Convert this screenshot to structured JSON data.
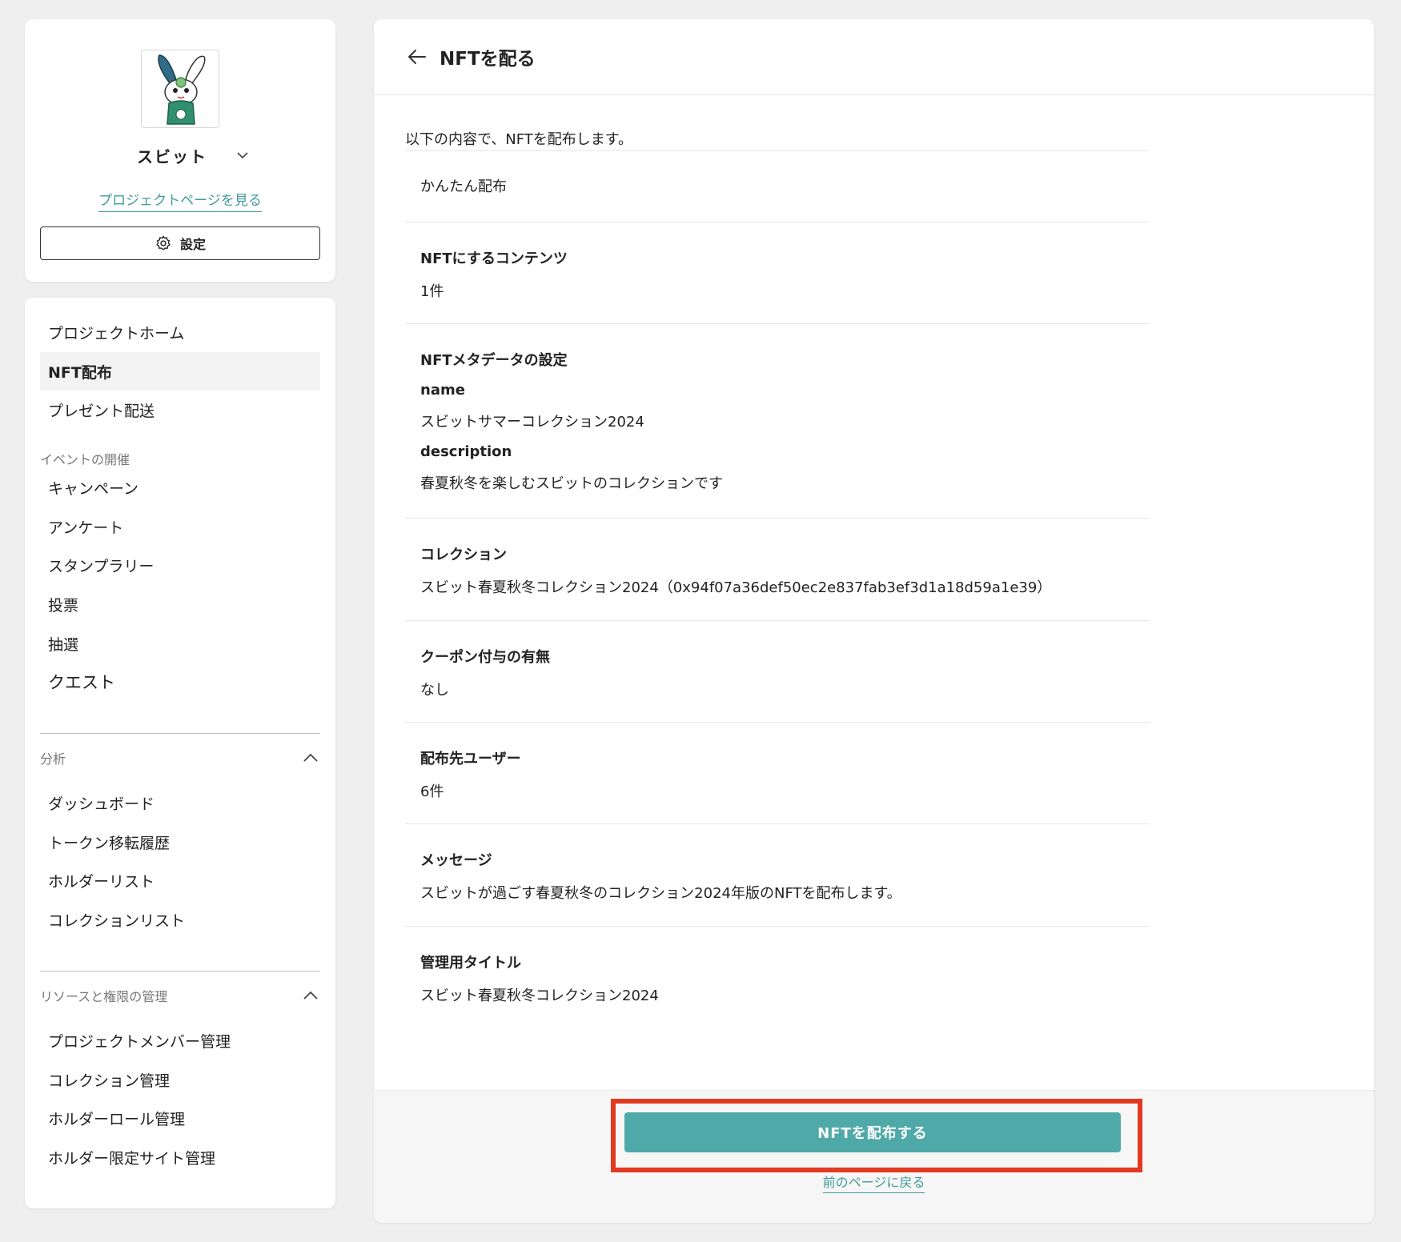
{
  "project": {
    "name": "スビット",
    "link_label": "プロジェクトページを見る",
    "settings_label": "設定"
  },
  "menu": {
    "top_items": [
      {
        "label": "プロジェクトホーム"
      },
      {
        "label": "NFT配布"
      },
      {
        "label": "プレゼント配送"
      }
    ],
    "event_group": {
      "title": "イベントの開催",
      "items": [
        {
          "label": "キャンペーン"
        },
        {
          "label": "アンケート"
        },
        {
          "label": "スタンプラリー"
        },
        {
          "label": "投票"
        },
        {
          "label": "抽選"
        },
        {
          "label": "クエスト"
        }
      ]
    },
    "analysis_group": {
      "title": "分析",
      "items": [
        {
          "label": "ダッシュボード"
        },
        {
          "label": "トークン移転履歴"
        },
        {
          "label": "ホルダーリスト"
        },
        {
          "label": "コレクションリスト"
        }
      ]
    },
    "resource_group": {
      "title": "リソースと権限の管理",
      "items": [
        {
          "label": "プロジェクトメンバー管理"
        },
        {
          "label": "コレクション管理"
        },
        {
          "label": "ホルダーロール管理"
        },
        {
          "label": "ホルダー限定サイト管理"
        }
      ]
    }
  },
  "main": {
    "title": "NFTを配る",
    "intro": "以下の内容で、NFTを配布します。",
    "method": "かんたん配布",
    "sections": {
      "contents": {
        "label": "NFTにするコンテンツ",
        "value": "1件"
      },
      "metadata": {
        "label": "NFTメタデータの設定",
        "name_key": "name",
        "name_value": "スビットサマーコレクション2024",
        "description_key": "description",
        "description_value": "春夏秋冬を楽しむスビットのコレクションです"
      },
      "collection": {
        "label": "コレクション",
        "value": "スビット春夏秋冬コレクション2024（0x94f07a36def50ec2e837fab3ef3d1a18d59a1e39）"
      },
      "coupon": {
        "label": "クーポン付与の有無",
        "value": "なし"
      },
      "recipients": {
        "label": "配布先ユーザー",
        "value": "6件"
      },
      "message": {
        "label": "メッセージ",
        "value": "スビットが過ごす春夏秋冬のコレクション2024年版のNFTを配布します。"
      },
      "admin_title": {
        "label": "管理用タイトル",
        "value": "スビット春夏秋冬コレクション2024"
      }
    },
    "submit_label": "NFTを配布する",
    "back_label": "前のページに戻る"
  },
  "colors": {
    "accent": "#4fa9a8",
    "link": "#3f9c99",
    "highlight": "#e23a22",
    "background": "#efefef"
  },
  "icons": {
    "back": "arrow-left-icon",
    "settings": "gear-icon",
    "dropdown": "chevron-down-icon",
    "collapse": "chevron-up-icon"
  }
}
